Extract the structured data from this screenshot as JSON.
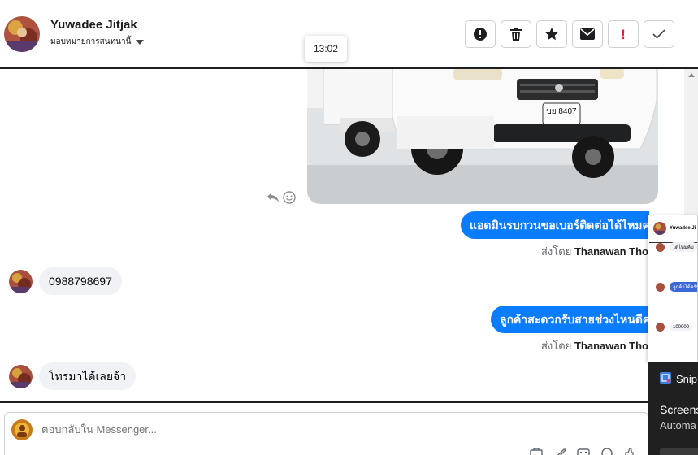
{
  "header": {
    "contact_name": "Yuwadee Jitjak",
    "assign_label": "มอบหมายการสนทนานี้",
    "tools": [
      {
        "name": "spam",
        "icon": "alert-circle-icon"
      },
      {
        "name": "delete",
        "icon": "trash-icon"
      },
      {
        "name": "star",
        "icon": "star-icon"
      },
      {
        "name": "mark-unread",
        "icon": "envelope-icon"
      },
      {
        "name": "important",
        "icon": "exclamation-icon",
        "text": "!"
      },
      {
        "name": "done",
        "icon": "check-icon"
      }
    ]
  },
  "tooltip": {
    "time": "13:02"
  },
  "messages": {
    "outgoing_1": "แอดมินรบกวนขอเบอร์ติดต่อได้ไหมคะ",
    "outgoing_2": "ลูกค้าสะดวกรับสายช่วงไหนดีคะ",
    "sent_by_prefix": "ส่งโดย",
    "sent_by_name": "Thanawan Thon",
    "incoming_1": "0988798697",
    "incoming_2": "โทรมาได้เลยจ้า",
    "photo_plate": "บย 8407"
  },
  "popup": {
    "name": "Yuwadee Ji",
    "rows": [
      "ได้ไหมคับ",
      "ลูกค้าได้ครับ",
      "100000"
    ]
  },
  "snip": {
    "title": "Snip",
    "line1": "Screens",
    "line2": "Automa"
  },
  "composer": {
    "placeholder": "ตอบกลับใน Messenger..."
  },
  "colors": {
    "messenger_blue": "#0a7cff",
    "incoming_bubble": "#f0f2f5",
    "important_red": "#e41e3f"
  }
}
